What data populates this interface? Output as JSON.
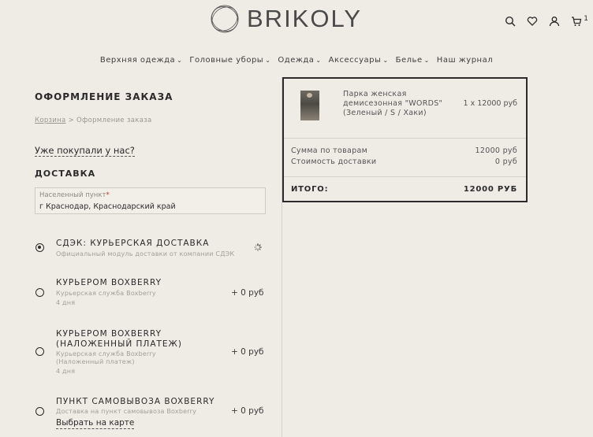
{
  "header": {
    "logo_text": "BRIKOLY",
    "cart_count": "1",
    "icons": [
      "search-icon",
      "heart-icon",
      "user-icon",
      "cart-icon"
    ]
  },
  "nav": [
    {
      "label": "Верхняя одежда",
      "chevron": true
    },
    {
      "label": "Головные уборы",
      "chevron": true
    },
    {
      "label": "Одежда",
      "chevron": true
    },
    {
      "label": "Аксессуары",
      "chevron": true
    },
    {
      "label": "Белье",
      "chevron": true
    },
    {
      "label": "Наш журнал",
      "chevron": false
    }
  ],
  "checkout": {
    "title": "ОФОРМЛЕНИЕ ЗАКАЗА",
    "breadcrumb": {
      "cart": "Корзина",
      "sep": ">",
      "current": "Оформление заказа"
    },
    "already_bought": "Уже покупали у нас?",
    "delivery_heading": "ДОСТАВКА",
    "city": {
      "label": "Населенный пункт",
      "required": "*",
      "value": "г Краснодар, Краснодарский край"
    }
  },
  "delivery_options": [
    {
      "title": "СДЭК: КУРЬЕРСКАЯ ДОСТАВКА",
      "subtitle": "Официальный модуль доставки от компании СДЭК",
      "price": "",
      "days": "",
      "selected": true
    },
    {
      "title": "КУРЬЕРОМ BOXBERRY",
      "subtitle": "Курьерская служба Boxberry",
      "price": "+ 0 руб",
      "days": "4 дня",
      "selected": false
    },
    {
      "title_line1": "КУРЬЕРОМ BOXBERRY",
      "title_line2": "(НАЛОЖЕННЫЙ ПЛАТЕЖ)",
      "subtitle_line1": "Курьерская служба Boxberry",
      "subtitle_line2": "(Наложенный платеж)",
      "price": "+ 0 руб",
      "days": "4 дня",
      "selected": false
    },
    {
      "title": "ПУНКТ САМОВЫВОЗА BOXBERRY",
      "subtitle": "Доставка на пункт самовывоза Boxberry",
      "price": "+ 0 руб",
      "link": "Выбрать на карте",
      "selected": false
    }
  ],
  "summary": {
    "product": {
      "name_line1": "Парка женская",
      "name_line2": "демисезонная \"WORDS\"",
      "name_line3": "(Зеленый / S / Хаки)",
      "qty_price": "1 x 12000 руб"
    },
    "goods_label": "Сумма по товарам",
    "goods_value": "12000 руб",
    "shipping_label": "Стоимость доставки",
    "shipping_value": "0 руб",
    "total_label": "ИТОГО:",
    "total_value": "12000 РУБ"
  }
}
